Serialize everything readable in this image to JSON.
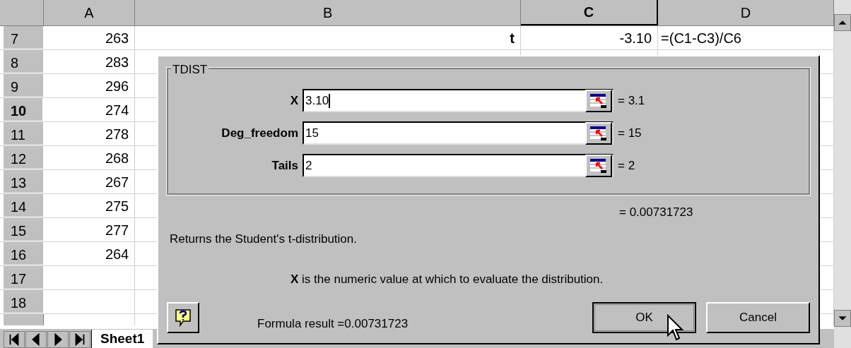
{
  "columns": [
    {
      "label": "A",
      "selected": false
    },
    {
      "label": "B",
      "selected": false
    },
    {
      "label": "C",
      "selected": true
    },
    {
      "label": "D",
      "selected": false
    }
  ],
  "rows": [
    {
      "header": "7",
      "selected": false,
      "cells": [
        "263",
        "t",
        "-3.10",
        "=(C1-C3)/C6"
      ]
    },
    {
      "header": "8",
      "selected": false,
      "cells": [
        "283",
        "",
        "",
        ""
      ]
    },
    {
      "header": "9",
      "selected": false,
      "cells": [
        "296",
        "",
        "",
        ""
      ]
    },
    {
      "header": "10",
      "selected": true,
      "cells": [
        "274",
        "",
        "",
        ""
      ]
    },
    {
      "header": "11",
      "selected": false,
      "cells": [
        "278",
        "",
        "",
        ""
      ]
    },
    {
      "header": "12",
      "selected": false,
      "cells": [
        "268",
        "",
        "",
        ""
      ]
    },
    {
      "header": "13",
      "selected": false,
      "cells": [
        "267",
        "",
        "",
        ""
      ]
    },
    {
      "header": "14",
      "selected": false,
      "cells": [
        "275",
        "",
        "",
        ""
      ]
    },
    {
      "header": "15",
      "selected": false,
      "cells": [
        "277",
        "",
        "",
        ""
      ]
    },
    {
      "header": "16",
      "selected": false,
      "cells": [
        "264",
        "",
        "",
        ""
      ]
    },
    {
      "header": "17",
      "selected": false,
      "cells": [
        "",
        "",
        "",
        ""
      ]
    },
    {
      "header": "18",
      "selected": false,
      "cells": [
        "",
        "",
        "",
        ""
      ]
    }
  ],
  "sheet_tabs": [
    {
      "label": "Sheet1",
      "selected": true
    }
  ],
  "dialog": {
    "group_title": "TDIST",
    "arguments": [
      {
        "label": "X",
        "value": "3.10",
        "result": "= 3.1",
        "focused": true
      },
      {
        "label": "Deg_freedom",
        "value": "15",
        "result": "= 15",
        "focused": false
      },
      {
        "label": "Tails",
        "value": "2",
        "result": "= 2",
        "focused": false
      }
    ],
    "result": "= 0.00731723",
    "description": "Returns the Student's t-distribution.",
    "argument_help": "**X** is the numeric value at which to evaluate the distribution.",
    "formula_result": "Formula result =0.00731723",
    "buttons": [
      {
        "label": "OK",
        "default": true
      },
      {
        "label": "Cancel",
        "default": false
      }
    ]
  }
}
